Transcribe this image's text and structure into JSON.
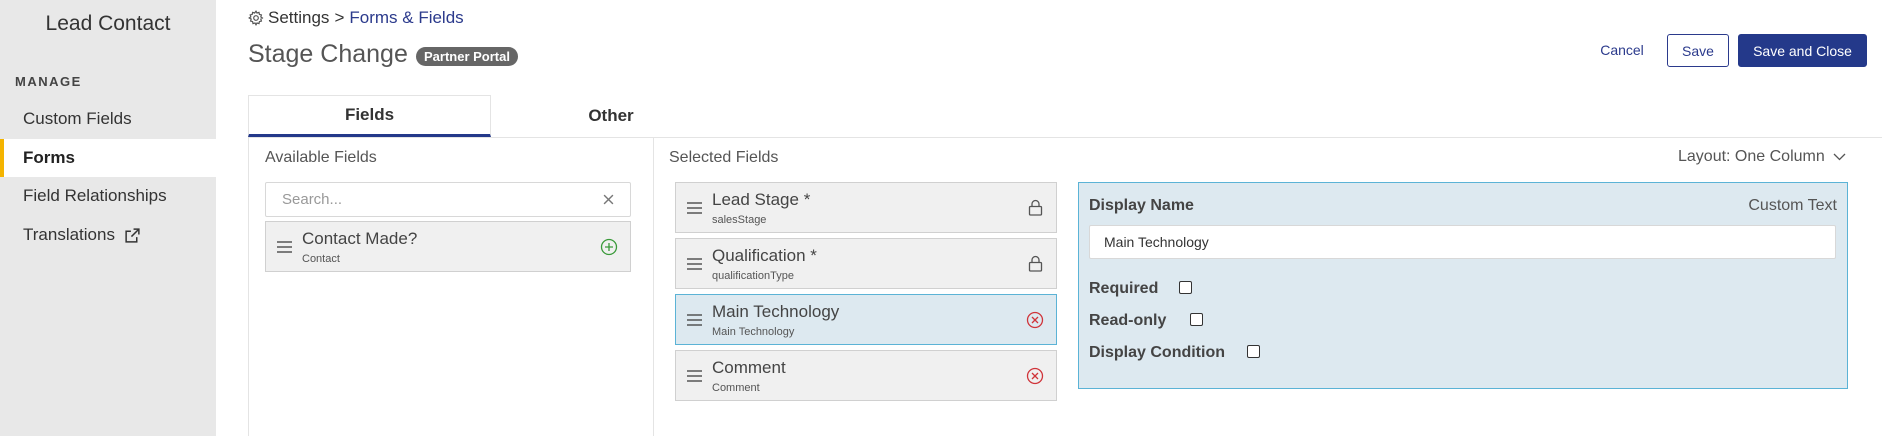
{
  "sidebar": {
    "title": "Lead Contact",
    "section": "MANAGE",
    "items": [
      {
        "label": "Custom Fields"
      },
      {
        "label": "Forms"
      },
      {
        "label": "Field Relationships"
      },
      {
        "label": "Translations"
      }
    ]
  },
  "header": {
    "breadcrumb_root": "Settings",
    "breadcrumb_sep": ">",
    "breadcrumb_current": "Forms & Fields",
    "title": "Stage Change",
    "badge": "Partner Portal",
    "cancel_label": "Cancel",
    "save_label": "Save",
    "save_close_label": "Save and Close"
  },
  "tabs": [
    {
      "label": "Fields"
    },
    {
      "label": "Other"
    }
  ],
  "available": {
    "heading": "Available Fields",
    "search_placeholder": "Search...",
    "fields": [
      {
        "name": "Contact Made?",
        "sub": "Contact"
      }
    ]
  },
  "selected": {
    "heading": "Selected Fields",
    "layout_label": "Layout: One Column",
    "fields": [
      {
        "name": "Lead Stage *",
        "sub": "salesStage",
        "action": "lock"
      },
      {
        "name": "Qualification *",
        "sub": "qualificationType",
        "action": "lock"
      },
      {
        "name": "Main Technology",
        "sub": "Main Technology",
        "action": "remove"
      },
      {
        "name": "Comment",
        "sub": "Comment",
        "action": "remove"
      }
    ]
  },
  "properties": {
    "display_name_label": "Display Name",
    "custom_text": "Custom Text",
    "display_name_value": "Main Technology",
    "required_label": "Required",
    "readonly_label": "Read-only",
    "display_condition_label": "Display Condition"
  },
  "colors": {
    "accent": "#24398a",
    "active_marker": "#f4b400",
    "selected_border": "#5bb3d6",
    "selected_bg": "#dde9f0",
    "add_icon": "#3a9a3a",
    "remove_icon": "#d0343a"
  }
}
